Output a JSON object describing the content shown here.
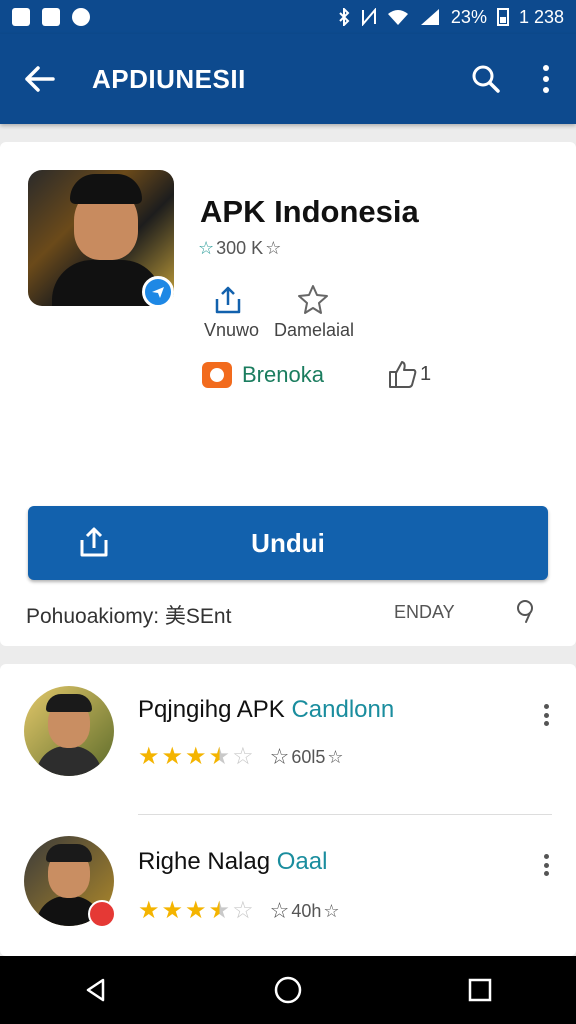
{
  "status_bar": {
    "battery_text": "23%",
    "time_text": "1 238",
    "left_icons": [
      "image-notification-icon",
      "photo-notification-icon",
      "messenger-notification-icon"
    ],
    "right_icons": [
      "bluetooth-icon",
      "nfc-icon",
      "wifi-icon",
      "signal-icon",
      "battery-icon"
    ]
  },
  "app_bar": {
    "title": "APDIUNESII",
    "color": "#0d4a8e"
  },
  "app": {
    "name": "APK Indonesia",
    "rating_text": "300 K",
    "actions": [
      {
        "label": "Vnuwo",
        "icon": "share-icon"
      },
      {
        "label": "Damelaial",
        "icon": "star-outline-icon"
      }
    ],
    "brand_label": "Brenoka",
    "like_count": "1",
    "download_label": "Undui",
    "footer_left": "Pohuoakiomy: 美SEnt",
    "footer_right": "ENDAY"
  },
  "reviews": [
    {
      "name": "Pqjngihg APK",
      "tag": "Candlonn",
      "stars": 3.5,
      "count_text": "60l5"
    },
    {
      "name": "Righe Nalag",
      "tag": "Oaal",
      "stars": 3.5,
      "count_text": "40h"
    }
  ],
  "nav_bar": {
    "buttons": [
      "back-nav-icon",
      "home-nav-icon",
      "recents-nav-icon"
    ]
  }
}
